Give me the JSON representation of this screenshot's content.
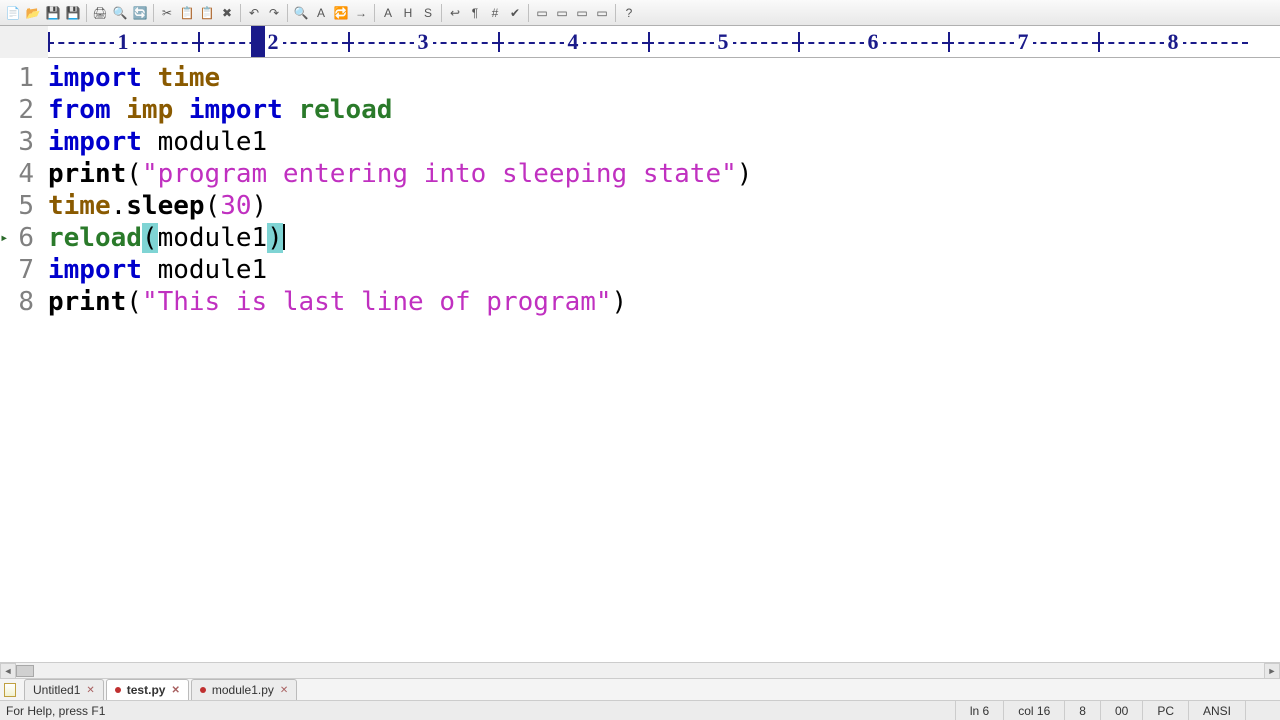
{
  "toolbar_icons": [
    "new",
    "open",
    "save",
    "save-all",
    "|",
    "print",
    "print-preview",
    "reload",
    "|",
    "cut",
    "copy",
    "paste",
    "delete",
    "|",
    "undo",
    "redo",
    "|",
    "find",
    "find-next",
    "replace",
    "goto",
    "|",
    "font-size",
    "html-tag",
    "strikethrough",
    "|",
    "wrap",
    "show-ws",
    "line-numbers",
    "check",
    "|",
    "panel-1",
    "panel-2",
    "panel-3",
    "panel-4",
    "|",
    "help"
  ],
  "ruler": {
    "numbers": [
      "1",
      "2",
      "3",
      "4",
      "5",
      "6",
      "7",
      "8"
    ],
    "cursor_at_units": 1.85
  },
  "gutter": [
    {
      "n": "1"
    },
    {
      "n": "2"
    },
    {
      "n": "3"
    },
    {
      "n": "4"
    },
    {
      "n": "5"
    },
    {
      "n": "6",
      "marker": true
    },
    {
      "n": "7"
    },
    {
      "n": "8"
    }
  ],
  "code": {
    "lines": [
      [
        {
          "t": "import ",
          "c": "kw"
        },
        {
          "t": "time",
          "c": "mod"
        }
      ],
      [
        {
          "t": "from ",
          "c": "kw"
        },
        {
          "t": "imp",
          "c": "mod"
        },
        {
          "t": " import ",
          "c": "kw"
        },
        {
          "t": "reload",
          "c": "name"
        }
      ],
      [
        {
          "t": "import ",
          "c": "kw"
        },
        {
          "t": "module1",
          "c": "id"
        }
      ],
      [
        {
          "t": "print",
          "c": "fn"
        },
        {
          "t": "(",
          "c": "id"
        },
        {
          "t": "\"program entering into sleeping state\"",
          "c": "str"
        },
        {
          "t": ")",
          "c": "id"
        }
      ],
      [
        {
          "t": "time",
          "c": "mod"
        },
        {
          "t": ".",
          "c": "id"
        },
        {
          "t": "sleep",
          "c": "fn"
        },
        {
          "t": "(",
          "c": "id"
        },
        {
          "t": "30",
          "c": "num"
        },
        {
          "t": ")",
          "c": "id"
        }
      ],
      [
        {
          "t": "reload",
          "c": "name"
        },
        {
          "t": "(",
          "c": "id paren-hl"
        },
        {
          "t": "module1",
          "c": "id"
        },
        {
          "t": ")",
          "c": "id paren-hl"
        },
        {
          "cursor": true
        }
      ],
      [
        {
          "t": "import ",
          "c": "kw"
        },
        {
          "t": "module1",
          "c": "id"
        }
      ],
      [
        {
          "t": "print",
          "c": "fn"
        },
        {
          "t": "(",
          "c": "id"
        },
        {
          "t": "\"This is last line of program\"",
          "c": "str"
        },
        {
          "t": ")",
          "c": "id"
        }
      ]
    ]
  },
  "tabs": [
    {
      "label": "Untitled1",
      "active": false,
      "modified": false
    },
    {
      "label": "test.py",
      "active": true,
      "modified": true
    },
    {
      "label": "module1.py",
      "active": false,
      "modified": true
    }
  ],
  "status": {
    "help": "For Help, press F1",
    "pos": "ln 6",
    "col": "col 16",
    "other1": "8",
    "other2": "00",
    "platform": "PC",
    "encoding": "ANSI"
  }
}
